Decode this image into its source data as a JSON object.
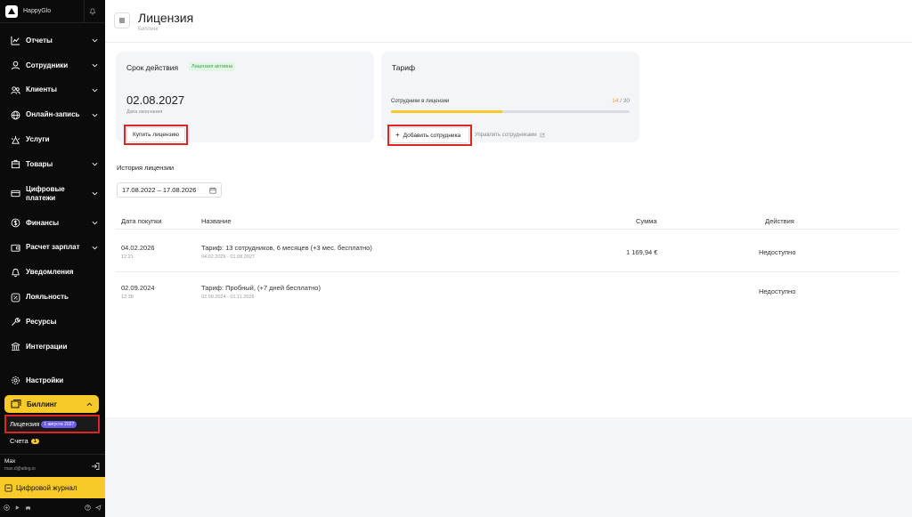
{
  "sidebar": {
    "brand": "HappyGlo",
    "items": [
      {
        "label": "Отчеты",
        "icon": "chart-icon",
        "chevron": true
      },
      {
        "label": "Сотрудники",
        "icon": "user-icon",
        "chevron": true
      },
      {
        "label": "Клиенты",
        "icon": "clients-icon",
        "chevron": true
      },
      {
        "label": "Онлайн-запись",
        "icon": "globe-icon",
        "chevron": true
      },
      {
        "label": "Услуги",
        "icon": "services-icon",
        "chevron": false
      },
      {
        "label": "Товары",
        "icon": "box-icon",
        "chevron": true
      },
      {
        "label": "Цифровые платежи",
        "icon": "card-icon",
        "chevron": true
      },
      {
        "label": "Финансы",
        "icon": "dollar-icon",
        "chevron": true
      },
      {
        "label": "Расчет зарплат",
        "icon": "wallet-icon",
        "chevron": true
      },
      {
        "label": "Уведомления",
        "icon": "bell-icon",
        "chevron": false
      },
      {
        "label": "Лояльность",
        "icon": "percent-icon",
        "chevron": false
      },
      {
        "label": "Ресурсы",
        "icon": "wrench-icon",
        "chevron": false
      },
      {
        "label": "Интеграции",
        "icon": "integration-icon",
        "chevron": false
      }
    ],
    "settings_label": "Настройки",
    "billing": {
      "label": "Биллинг",
      "sub_license": "Лицензия",
      "sub_license_badge": "1 августа 2027",
      "sub_invoices": "Счета",
      "sub_invoices_badge": "1"
    },
    "user": {
      "name": "Max",
      "email": "max.d@alteg.io"
    },
    "journal_label": "Цифровой журнал"
  },
  "header": {
    "title": "Лицензия",
    "breadcrumb": "Биллинг"
  },
  "license_card": {
    "title": "Срок действия",
    "status": "Лицензия активна",
    "date": "02.08.2027",
    "date_label": "Дата окончания",
    "buy_button": "Купить лицензию"
  },
  "tariff_card": {
    "title": "Тариф",
    "employees_label": "Сотрудники в лицензии",
    "employees_current": "14",
    "employees_total": "/ 30",
    "progress_fraction": 0.467,
    "add_button": "Добавить сотрудника",
    "manage_link": "Управлять сотрудниками"
  },
  "history": {
    "title": "История лицензии",
    "date_range": "17.08.2022 – 17.08.2026",
    "columns": {
      "date": "Дата покупки",
      "name": "Название",
      "sum": "Сумма",
      "actions": "Действия"
    },
    "rows": [
      {
        "date": "04.02.2026",
        "time": "12:21",
        "name": "Тариф: 13 сотрудников, 6 месяцев (+3 мес. бесплатно)",
        "period": "04.02.2026 - 01.08.2027",
        "sum": "1 169,94 €",
        "action": "Недоступно"
      },
      {
        "date": "02.09.2024",
        "time": "12:38",
        "name": "Тариф: Пробный, (+7 дней бесплатно)",
        "period": "02.09.2024 - 01.11.2026",
        "sum": "",
        "action": "Недоступно"
      }
    ]
  },
  "colors": {
    "accent": "#f7c929",
    "sidebar_bg": "#0b0b0b",
    "highlight": "#e02424",
    "success": "#36a54c"
  }
}
